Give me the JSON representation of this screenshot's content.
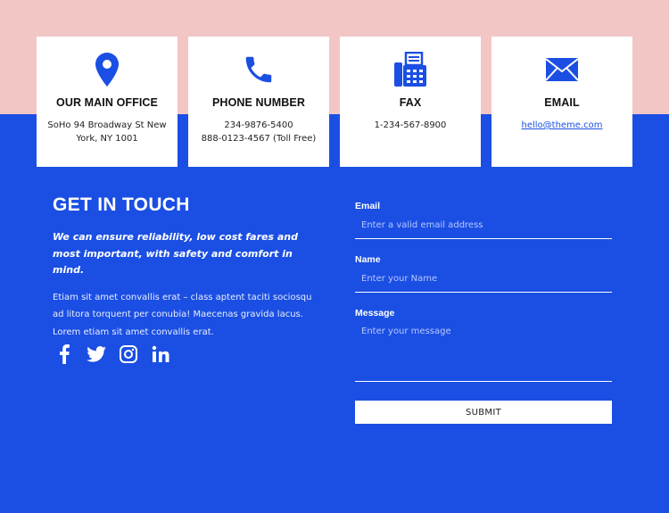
{
  "colors": {
    "accent": "#1b4fe3",
    "band": "#f3c6c6",
    "card": "#ffffff"
  },
  "cards": [
    {
      "icon": "location-pin-icon",
      "title": "OUR MAIN OFFICE",
      "line1": "SoHo 94 Broadway St New",
      "line2": "York, NY 1001"
    },
    {
      "icon": "phone-icon",
      "title": "PHONE NUMBER",
      "line1": "234-9876-5400",
      "line2": "888-0123-4567 (Toll Free)"
    },
    {
      "icon": "fax-icon",
      "title": "FAX",
      "line1": "1-234-567-8900"
    },
    {
      "icon": "envelope-icon",
      "title": "EMAIL",
      "line1": "hello@theme.com"
    }
  ],
  "contact": {
    "heading": "GET IN TOUCH",
    "lead": "We can ensure reliability, low cost fares and most important, with safety and comfort in mind.",
    "body": "Etiam sit amet convallis erat – class aptent taciti sociosqu ad litora torquent per conubia! Maecenas gravida lacus. Lorem etiam sit amet convallis erat."
  },
  "social": [
    "facebook-icon",
    "twitter-icon",
    "instagram-icon",
    "linkedin-icon"
  ],
  "form": {
    "email_label": "Email",
    "email_placeholder": "Enter a valid email address",
    "name_label": "Name",
    "name_placeholder": "Enter your Name",
    "message_label": "Message",
    "message_placeholder": "Enter your message",
    "submit_label": "SUBMIT"
  }
}
